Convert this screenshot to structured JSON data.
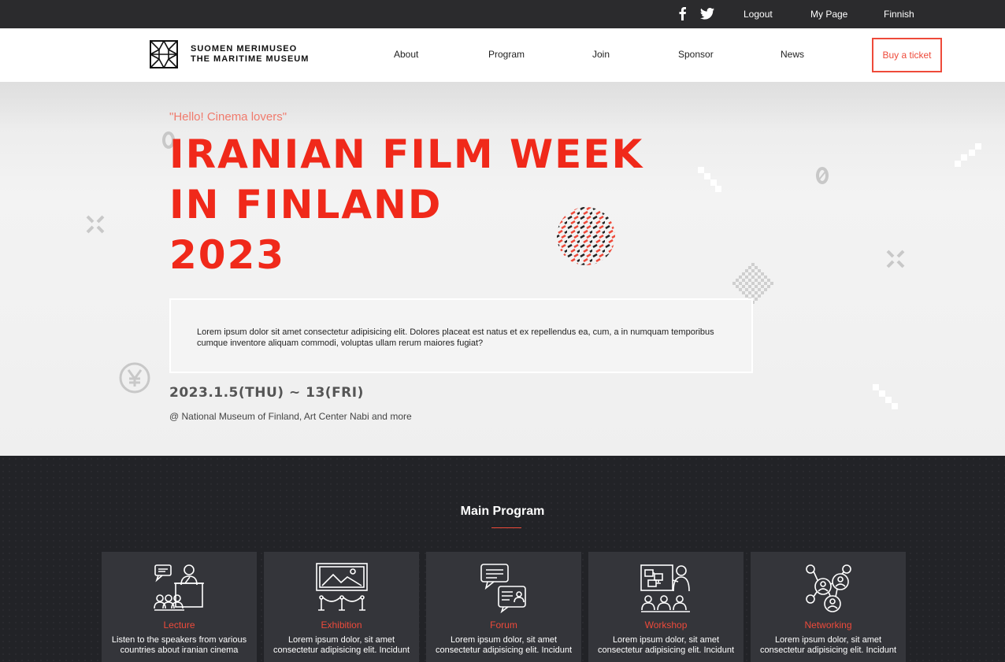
{
  "topbar": {
    "social": [
      "facebook-icon",
      "twitter-icon"
    ],
    "logout": "Logout",
    "mypage": "My Page",
    "language": "Finnish"
  },
  "header": {
    "logo_line1": "SUOMEN MERIMUSEO",
    "logo_line2": "THE MARITIME MUSEUM",
    "nav": [
      "About",
      "Program",
      "Join",
      "Sponsor",
      "News"
    ],
    "buy_ticket": "Buy a ticket"
  },
  "hero": {
    "tagline": "\"Hello! Cinema lovers\"",
    "title_lines": [
      "IRANIAN FILM WEEK",
      "IN FINLAND",
      "2023"
    ],
    "description": "Lorem ipsum dolor sit amet consectetur adipisicing elit. Dolores placeat est natus et ex repellendus ea, cum, a in numquam temporibus cumque inventore aliquam commodi, voluptas ullam rerum maiores fugiat?",
    "dates": "2023.1.5(THU) ~ 13(FRI)",
    "venue": "@ National Museum of Finland, Art Center Nabi and more"
  },
  "program": {
    "title": "Main Program",
    "cards": [
      {
        "name": "Lecture",
        "text": "Listen to the speakers from various countries about iranian cinema",
        "icon": "lecture-icon"
      },
      {
        "name": "Exhibition",
        "text": "Lorem ipsum dolor, sit amet consectetur adipisicing elit. Incidunt",
        "icon": "exhibition-icon"
      },
      {
        "name": "Forum",
        "text": "Lorem ipsum dolor, sit amet consectetur adipisicing elit. Incidunt",
        "icon": "forum-icon"
      },
      {
        "name": "Workshop",
        "text": "Lorem ipsum dolor, sit amet consectetur adipisicing elit. Incidunt",
        "icon": "workshop-icon"
      },
      {
        "name": "Networking",
        "text": "Lorem ipsum dolor, sit amet consectetur adipisicing elit. Incidunt",
        "icon": "networking-icon"
      }
    ]
  },
  "colors": {
    "accent": "#ee4a3a",
    "title_red": "#f0291a",
    "topbar": "#2b2b2d",
    "program_bg": "#222327",
    "card_bg": "#34353a"
  }
}
